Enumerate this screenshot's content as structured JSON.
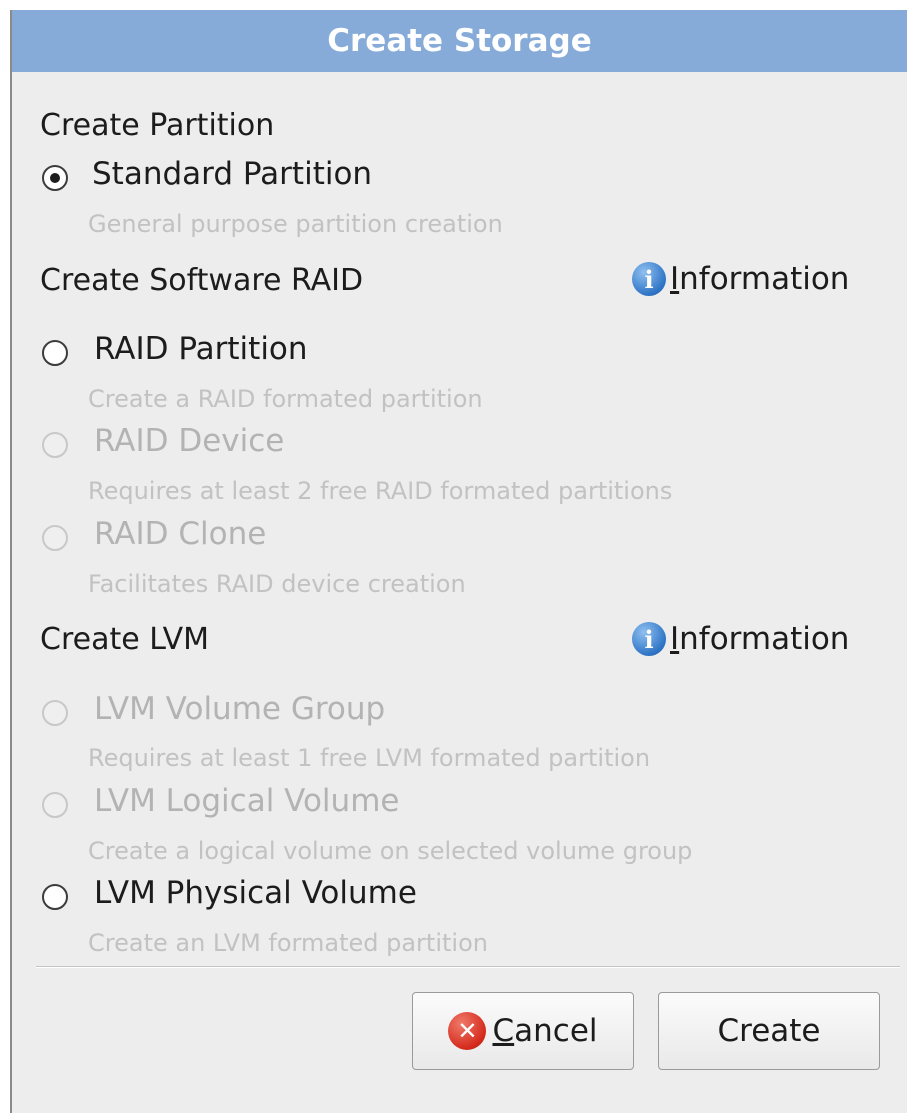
{
  "dialog": {
    "title": "Create Storage",
    "sections": {
      "partition": {
        "heading": "Create Partition",
        "options": [
          {
            "label": "Standard Partition",
            "description": "General purpose partition creation",
            "selected": true,
            "enabled": true
          }
        ]
      },
      "software_raid": {
        "heading": "Create Software RAID",
        "info_label_prefix": "I",
        "info_label_rest": "nformation",
        "options": [
          {
            "label": "RAID Partition",
            "description": "Create a RAID formated partition",
            "selected": false,
            "enabled": true
          },
          {
            "label": "RAID Device",
            "description": "Requires at least 2 free RAID formated partitions",
            "selected": false,
            "enabled": false
          },
          {
            "label": "RAID Clone",
            "description": "Facilitates RAID device creation",
            "selected": false,
            "enabled": false
          }
        ]
      },
      "lvm": {
        "heading": "Create LVM",
        "info_label_prefix": "I",
        "info_label_rest": "nformation",
        "options": [
          {
            "label": "LVM Volume Group",
            "description": "Requires at least 1 free LVM formated partition",
            "selected": false,
            "enabled": false
          },
          {
            "label": "LVM Logical Volume",
            "description": "Create a logical volume on selected volume group",
            "selected": false,
            "enabled": false
          },
          {
            "label": "LVM Physical Volume",
            "description": "Create an LVM formated partition",
            "selected": false,
            "enabled": true
          }
        ]
      }
    },
    "buttons": {
      "cancel_mnemonic": "C",
      "cancel_rest": "ancel",
      "create": "Create"
    },
    "icons": {
      "info": "information-icon",
      "cancel": "cancel-icon",
      "info_glyph": "i",
      "cancel_glyph": "✕"
    },
    "colors": {
      "titlebar": "#86abd9",
      "disabled_text": "#b3b3b3"
    }
  }
}
